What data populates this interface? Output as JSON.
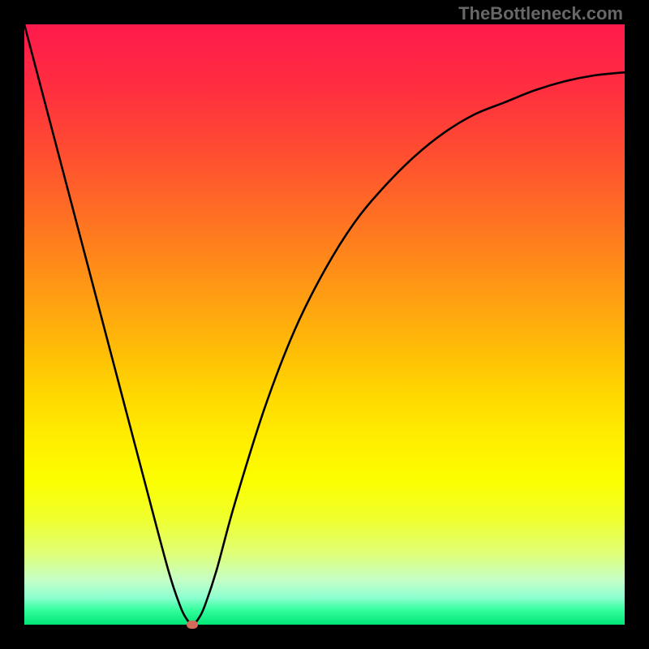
{
  "attribution": "TheBottleneck.com",
  "chart_data": {
    "type": "line",
    "title": "",
    "xlabel": "",
    "ylabel": "",
    "xlim": [
      0,
      100
    ],
    "ylim": [
      0,
      100
    ],
    "legend": false,
    "grid": false,
    "background_gradient": [
      {
        "pos": 0.0,
        "color": "#FF1A4D"
      },
      {
        "pos": 0.11,
        "color": "#FF2F3F"
      },
      {
        "pos": 0.22,
        "color": "#FF4F30"
      },
      {
        "pos": 0.33,
        "color": "#FF7322"
      },
      {
        "pos": 0.44,
        "color": "#FF9914"
      },
      {
        "pos": 0.55,
        "color": "#FFBF06"
      },
      {
        "pos": 0.62,
        "color": "#FFD900"
      },
      {
        "pos": 0.69,
        "color": "#FFED00"
      },
      {
        "pos": 0.76,
        "color": "#FCFF00"
      },
      {
        "pos": 0.82,
        "color": "#F0FF2A"
      },
      {
        "pos": 0.88,
        "color": "#E0FF75"
      },
      {
        "pos": 0.925,
        "color": "#C6FFC6"
      },
      {
        "pos": 0.955,
        "color": "#8DFFD0"
      },
      {
        "pos": 0.975,
        "color": "#35FF9E"
      },
      {
        "pos": 1.0,
        "color": "#00E676"
      }
    ],
    "series": [
      {
        "name": "bottleneck-curve",
        "color": "#000000",
        "x": [
          0,
          5,
          10,
          15,
          20,
          24,
          26,
          27,
          28,
          29,
          30,
          32,
          35,
          40,
          45,
          50,
          55,
          60,
          65,
          70,
          75,
          80,
          85,
          90,
          95,
          100
        ],
        "y": [
          100,
          81,
          62,
          43,
          24,
          9,
          3,
          1,
          0,
          1,
          3,
          9,
          20,
          36,
          49,
          59,
          67,
          73,
          78,
          82,
          85,
          87,
          89,
          90.5,
          91.5,
          92
        ]
      }
    ],
    "marker": {
      "x": 28,
      "y": 0,
      "color": "#D36A5C",
      "shape": "rounded-rect"
    }
  }
}
